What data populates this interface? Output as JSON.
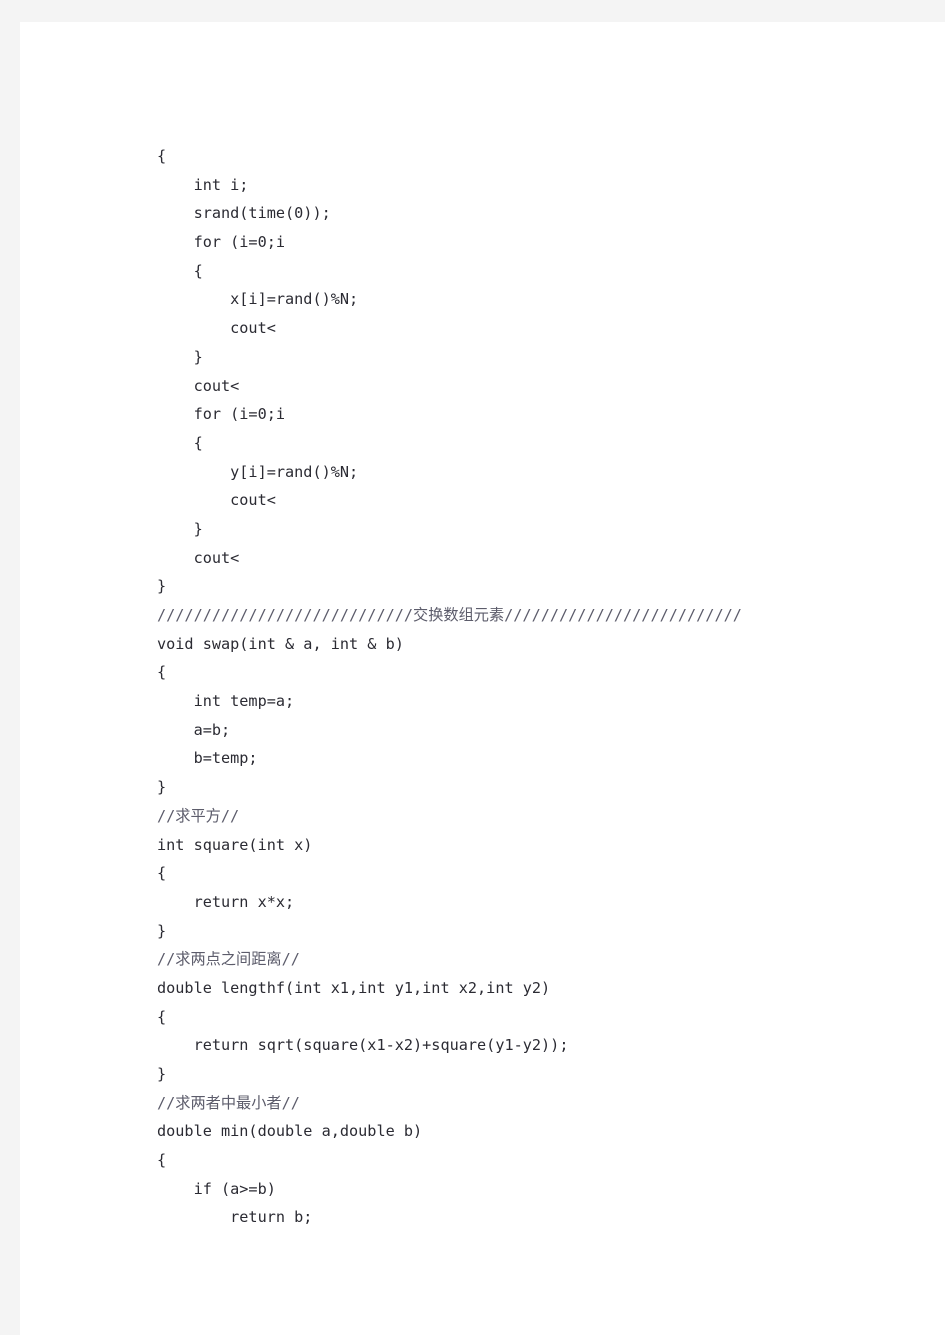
{
  "document": {
    "type": "code-listing",
    "language": "C++",
    "page_background": "#ffffff",
    "canvas_background": "#f4f4f4",
    "text_color": "#2b2b33",
    "comment_color": "#5c5c6b"
  },
  "code": {
    "lines": [
      {
        "id": "line-1",
        "text": "{",
        "kind": "code"
      },
      {
        "id": "line-2",
        "text": "    int i;",
        "kind": "code"
      },
      {
        "id": "line-3",
        "text": "    srand(time(0));",
        "kind": "code"
      },
      {
        "id": "line-4",
        "text": "    for (i=0;i",
        "kind": "code"
      },
      {
        "id": "line-5",
        "text": "    {",
        "kind": "code"
      },
      {
        "id": "line-6",
        "text": "        x[i]=rand()%N;",
        "kind": "code"
      },
      {
        "id": "line-7",
        "text": "        cout<",
        "kind": "code"
      },
      {
        "id": "line-8",
        "text": "    }",
        "kind": "code"
      },
      {
        "id": "line-9",
        "text": "    cout<",
        "kind": "code"
      },
      {
        "id": "line-10",
        "text": "    for (i=0;i",
        "kind": "code"
      },
      {
        "id": "line-11",
        "text": "    {",
        "kind": "code"
      },
      {
        "id": "line-12",
        "text": "        y[i]=rand()%N;",
        "kind": "code"
      },
      {
        "id": "line-13",
        "text": "        cout<",
        "kind": "code"
      },
      {
        "id": "line-14",
        "text": "    }",
        "kind": "code"
      },
      {
        "id": "line-15",
        "text": "    cout<",
        "kind": "code"
      },
      {
        "id": "line-16",
        "text": "}",
        "kind": "code"
      },
      {
        "id": "line-17",
        "text": "////////////////////////////交换数组元素//////////////////////////",
        "kind": "comment-cjk"
      },
      {
        "id": "line-18",
        "text": "void swap(int & a, int & b)",
        "kind": "code"
      },
      {
        "id": "line-19",
        "text": "{",
        "kind": "code"
      },
      {
        "id": "line-20",
        "text": "    int temp=a;",
        "kind": "code"
      },
      {
        "id": "line-21",
        "text": "    a=b;",
        "kind": "code"
      },
      {
        "id": "line-22",
        "text": "    b=temp;",
        "kind": "code"
      },
      {
        "id": "line-23",
        "text": "}",
        "kind": "code"
      },
      {
        "id": "line-24",
        "text": "//求平方//",
        "kind": "comment-cjk"
      },
      {
        "id": "line-25",
        "text": "int square(int x)",
        "kind": "code"
      },
      {
        "id": "line-26",
        "text": "{",
        "kind": "code"
      },
      {
        "id": "line-27",
        "text": "    return x*x;",
        "kind": "code"
      },
      {
        "id": "line-28",
        "text": "}",
        "kind": "code"
      },
      {
        "id": "line-29",
        "text": "//求两点之间距离//",
        "kind": "comment-cjk"
      },
      {
        "id": "line-30",
        "text": "double lengthf(int x1,int y1,int x2,int y2)",
        "kind": "code"
      },
      {
        "id": "line-31",
        "text": "{",
        "kind": "code"
      },
      {
        "id": "line-32",
        "text": "    return sqrt(square(x1-x2)+square(y1-y2));",
        "kind": "code"
      },
      {
        "id": "line-33",
        "text": "}",
        "kind": "code"
      },
      {
        "id": "line-34",
        "text": "//求两者中最小者//",
        "kind": "comment-cjk"
      },
      {
        "id": "line-35",
        "text": "double min(double a,double b)",
        "kind": "code"
      },
      {
        "id": "line-36",
        "text": "{",
        "kind": "code"
      },
      {
        "id": "line-37",
        "text": "    if (a>=b)",
        "kind": "code"
      },
      {
        "id": "line-38",
        "text": "        return b;",
        "kind": "code"
      }
    ]
  }
}
